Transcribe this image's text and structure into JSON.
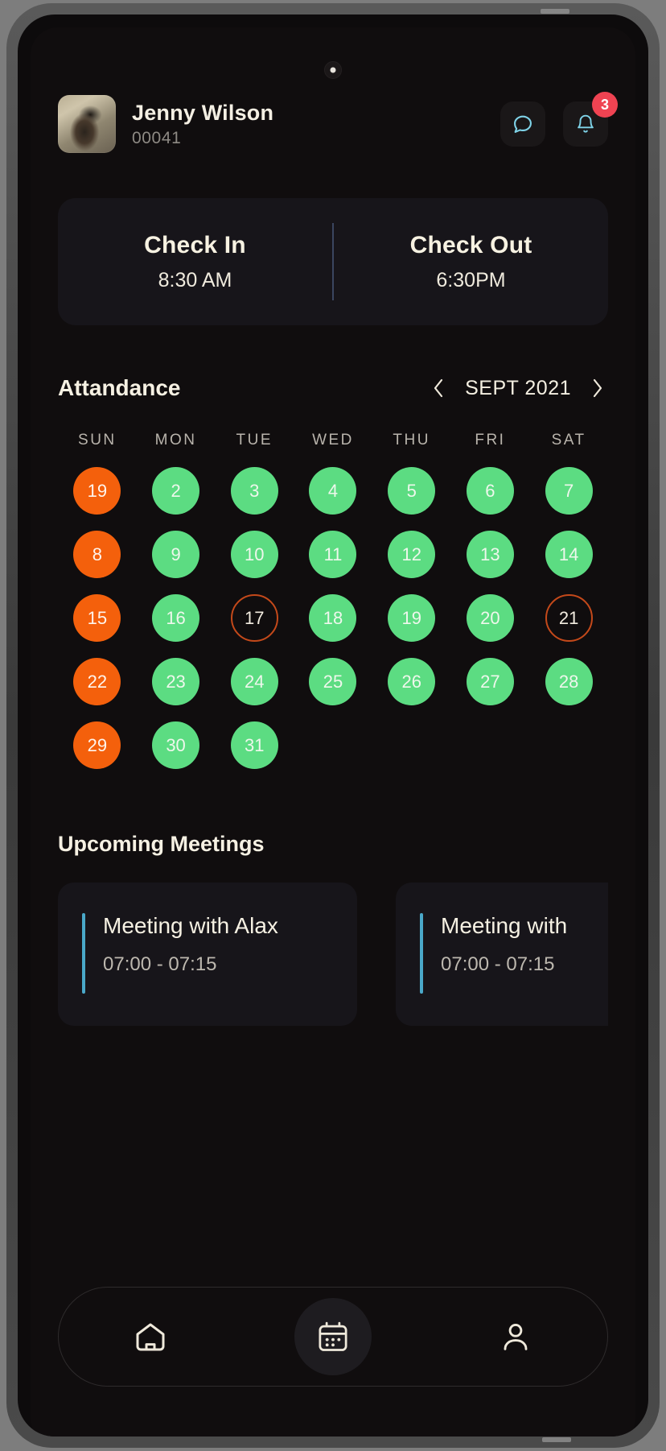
{
  "header": {
    "avatar_name": "user-avatar-photo",
    "user_name": "Jenny Wilson",
    "user_id": "00041",
    "chat_icon": "chat-bubble-icon",
    "bell_icon": "bell-icon",
    "notification_count": "3",
    "badge_color": "#ef4352",
    "icon_color": "#7fd3e8"
  },
  "attendance_card": {
    "check_in_label": "Check In",
    "check_in_time": "8:30 AM",
    "check_out_label": "Check Out",
    "check_out_time": "6:30PM"
  },
  "calendar": {
    "title": "Attandance",
    "prev_icon": "chevron-left-icon",
    "next_icon": "chevron-right-icon",
    "month_label": "SEPT 2021",
    "weekdays": [
      "SUN",
      "MON",
      "TUE",
      "WED",
      "THU",
      "FRI",
      "SAT"
    ],
    "colors": {
      "present": "#5cdc82",
      "absent": "#f4600c",
      "today_outline": "#c4491a"
    },
    "weeks": [
      [
        {
          "day": "19",
          "state": "orange"
        },
        {
          "day": "2",
          "state": "green"
        },
        {
          "day": "3",
          "state": "green"
        },
        {
          "day": "4",
          "state": "green"
        },
        {
          "day": "5",
          "state": "green"
        },
        {
          "day": "6",
          "state": "green"
        },
        {
          "day": "7",
          "state": "green"
        }
      ],
      [
        {
          "day": "8",
          "state": "orange"
        },
        {
          "day": "9",
          "state": "green"
        },
        {
          "day": "10",
          "state": "green"
        },
        {
          "day": "11",
          "state": "green"
        },
        {
          "day": "12",
          "state": "green"
        },
        {
          "day": "13",
          "state": "green"
        },
        {
          "day": "14",
          "state": "green"
        }
      ],
      [
        {
          "day": "15",
          "state": "orange"
        },
        {
          "day": "16",
          "state": "green"
        },
        {
          "day": "17",
          "state": "outline"
        },
        {
          "day": "18",
          "state": "green"
        },
        {
          "day": "19",
          "state": "green"
        },
        {
          "day": "20",
          "state": "green"
        },
        {
          "day": "21",
          "state": "outline"
        }
      ],
      [
        {
          "day": "22",
          "state": "orange"
        },
        {
          "day": "23",
          "state": "green"
        },
        {
          "day": "24",
          "state": "green"
        },
        {
          "day": "25",
          "state": "green"
        },
        {
          "day": "26",
          "state": "green"
        },
        {
          "day": "27",
          "state": "green"
        },
        {
          "day": "28",
          "state": "green"
        }
      ],
      [
        {
          "day": "29",
          "state": "orange"
        },
        {
          "day": "30",
          "state": "green"
        },
        {
          "day": "31",
          "state": "green"
        },
        {
          "day": "",
          "state": "empty"
        },
        {
          "day": "",
          "state": "empty"
        },
        {
          "day": "",
          "state": "empty"
        },
        {
          "day": "",
          "state": "empty"
        }
      ]
    ]
  },
  "meetings": {
    "title": "Upcoming Meetings",
    "accent_color": "#4aa8c9",
    "items": [
      {
        "name": "Meeting with Alax",
        "time": "07:00 - 07:15"
      },
      {
        "name": "Meeting with",
        "time": "07:00 - 07:15"
      }
    ]
  },
  "bottom_nav": {
    "items": [
      {
        "icon": "home-icon",
        "active": "false"
      },
      {
        "icon": "calendar-icon",
        "active": "true"
      },
      {
        "icon": "profile-icon",
        "active": "false"
      }
    ]
  }
}
